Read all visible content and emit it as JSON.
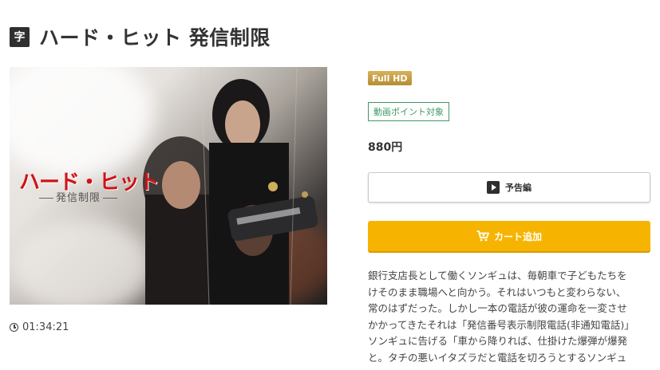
{
  "header": {
    "subtitle_badge": "字",
    "title": "ハード・ヒット 発信制限"
  },
  "poster": {
    "title": "ハード・ヒット",
    "subtitle": "発信制限"
  },
  "duration": "01:34:21",
  "badges": {
    "quality": "Full HD",
    "point": "動画ポイント対象"
  },
  "price": "880円",
  "buttons": {
    "trailer": "予告編",
    "cart": "カート追加"
  },
  "description": [
    "銀行支店長として働くソンギュは、毎朝車で子どもたちを",
    "けそのまま職場へと向かう。それはいつもと変わらない、",
    "常のはずだった。しかし一本の電話が彼の運命を一変させ",
    "かかってきたそれは「発信番号表示制限電話(非通知電話)」",
    "ソンギュに告げる「車から降りれば、仕掛けた爆弾が爆発",
    "と。タチの悪いイタズラだと電話を切ろうとするソンギュ"
  ],
  "colors": {
    "accent_yellow": "#f6b400",
    "hd_gold": "#c9a046",
    "point_green": "#3f9a62",
    "poster_red": "#d01218"
  }
}
